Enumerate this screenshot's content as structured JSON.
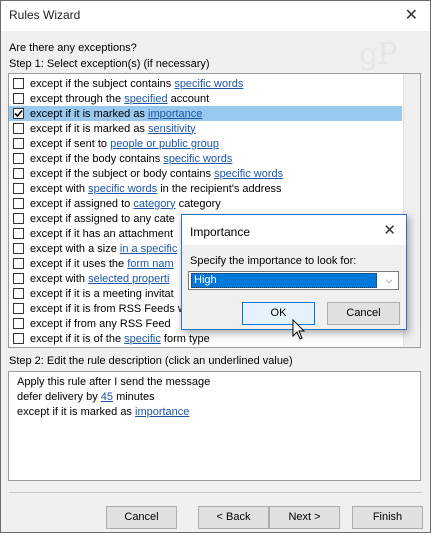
{
  "window": {
    "title": "Rules Wizard",
    "close_glyph": "✕"
  },
  "watermark": "gP",
  "question": "Are there any exceptions?",
  "step1_label": "Step 1: Select exception(s) (if necessary)",
  "exceptions": [
    {
      "pre": "except if the subject contains ",
      "link": "specific words",
      "post": "",
      "checked": false
    },
    {
      "pre": "except through the ",
      "link": "specified",
      "post": " account",
      "checked": false
    },
    {
      "pre": "except if it is marked as ",
      "link": "importance",
      "post": "",
      "checked": true,
      "selected": true
    },
    {
      "pre": "except if it is marked as ",
      "link": "sensitivity",
      "post": "",
      "checked": false
    },
    {
      "pre": "except if sent to ",
      "link": "people or public group",
      "post": "",
      "checked": false
    },
    {
      "pre": "except if the body contains ",
      "link": "specific words",
      "post": "",
      "checked": false
    },
    {
      "pre": "except if the subject or body contains ",
      "link": "specific words",
      "post": "",
      "checked": false
    },
    {
      "pre": "except with ",
      "link": "specific words",
      "post": " in the recipient's address",
      "checked": false
    },
    {
      "pre": "except if assigned to ",
      "link": "category",
      "post": " category",
      "checked": false
    },
    {
      "pre": "except if assigned to any cate",
      "link": "",
      "post": "",
      "checked": false
    },
    {
      "pre": "except if it has an attachment",
      "link": "",
      "post": "",
      "checked": false
    },
    {
      "pre": "except with a size ",
      "link": "in a specific",
      "post": "",
      "checked": false
    },
    {
      "pre": "except if it uses the ",
      "link": "form nam",
      "post": "",
      "checked": false
    },
    {
      "pre": "except with ",
      "link": "selected properti",
      "post": "",
      "checked": false
    },
    {
      "pre": "except if it is a meeting invitat",
      "link": "",
      "post": "",
      "checked": false
    },
    {
      "pre": "except if it is from RSS Feeds w",
      "link": "",
      "post": "",
      "checked": false
    },
    {
      "pre": "except if from any RSS Feed",
      "link": "",
      "post": "",
      "checked": false
    },
    {
      "pre": "except if it is of the ",
      "link": "specific",
      "post": " form type",
      "checked": false
    }
  ],
  "step2_label": "Step 2: Edit the rule description (click an underlined value)",
  "description": {
    "line1": "Apply this rule after I send the message",
    "line2_pre": "defer delivery by ",
    "line2_link": "45",
    "line2_post": " minutes",
    "line3_pre": "except if it is marked as ",
    "line3_link": "importance"
  },
  "buttons": {
    "cancel": "Cancel",
    "back": "< Back",
    "next": "Next >",
    "finish": "Finish"
  },
  "dialog": {
    "title": "Importance",
    "close_glyph": "✕",
    "label": "Specify the importance to look for:",
    "selected_value": "High",
    "chevron_glyph": "⌵",
    "ok": "OK",
    "cancel": "Cancel"
  },
  "colors": {
    "link": "#1d56a6",
    "selection": "#99c9ef",
    "accent": "#0078d7"
  },
  "icons": {
    "check": "check-icon",
    "cursor": "mouse-pointer-icon"
  }
}
